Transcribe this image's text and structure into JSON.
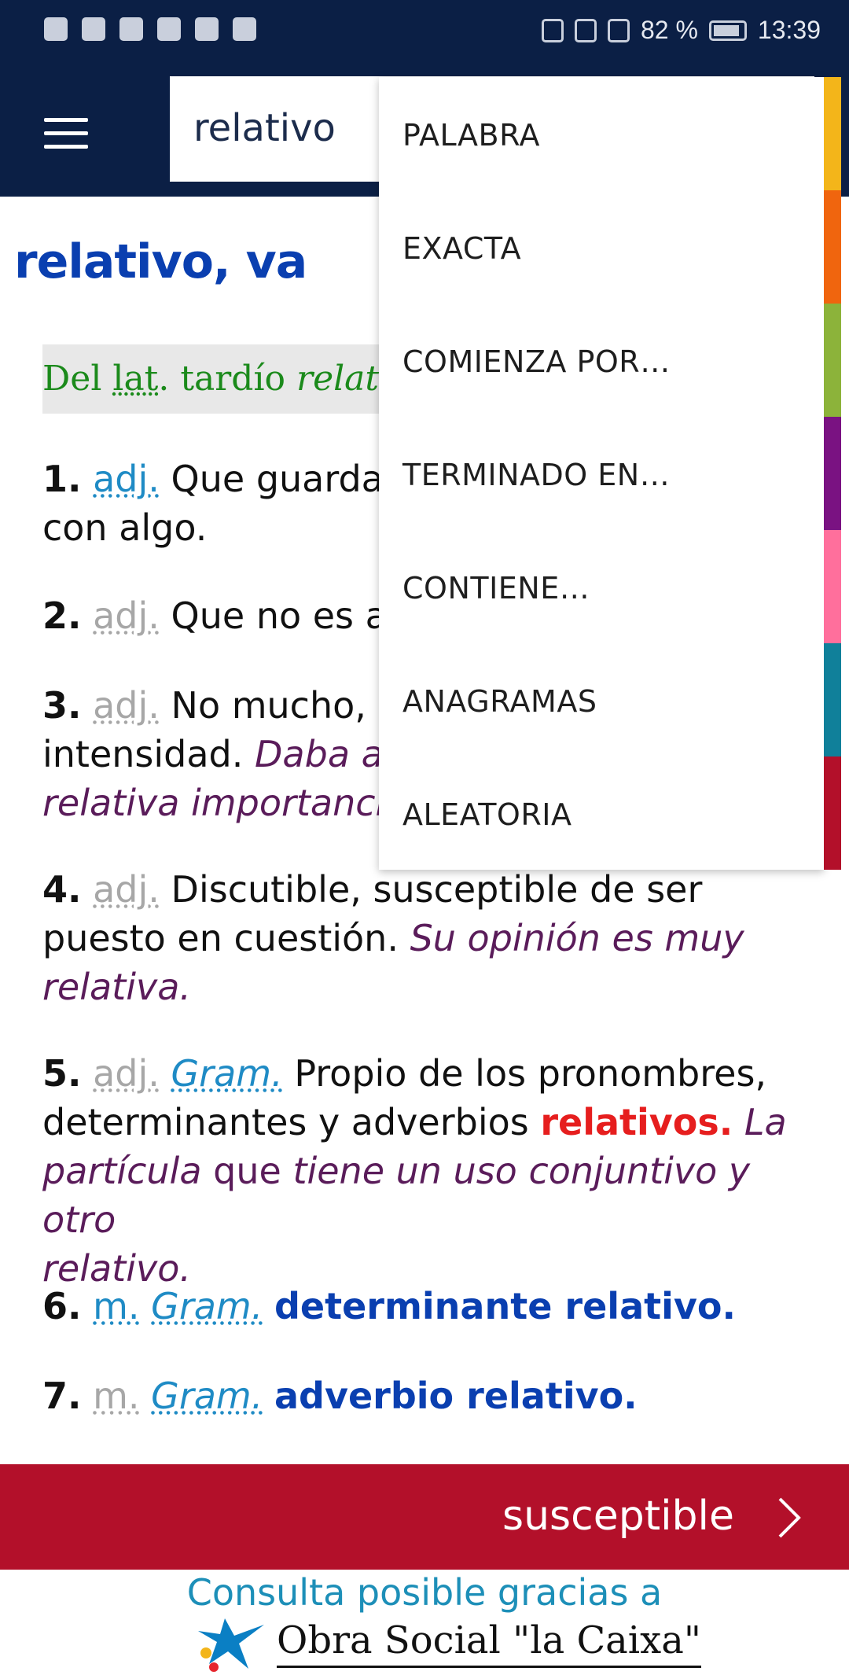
{
  "status_bar": {
    "battery": "82 %",
    "time": "13:39"
  },
  "search": {
    "query": "relativo"
  },
  "entry": {
    "title": "relativo, va",
    "etymology": {
      "prefix": "Del ",
      "abbr": "lat",
      "dot": ".",
      "middle": " tardío ",
      "word": "relatīvus"
    },
    "acepciones": [
      {
        "num": "1.",
        "tag": "adj.",
        "text": "Que guarda",
        "text2": "con algo."
      },
      {
        "num": "2.",
        "tag": "adj.",
        "text": "Que no es a"
      },
      {
        "num": "3.",
        "tag": "adj.",
        "text": "No mucho, e",
        "text2": "intensidad.",
        "example": "Daba a",
        "example2": "relativa importancia"
      },
      {
        "num": "4.",
        "tag": "adj.",
        "text": "Discutible, susceptible de ser",
        "text2": "puesto en cuestión.",
        "example": "Su opinión es muy",
        "example2": "relativa."
      },
      {
        "num": "5.",
        "tag": "adj.",
        "tag2": "Gram.",
        "text": "Propio de los pronombres,",
        "text2": "determinantes y adverbios",
        "highlight": "relativos.",
        "example": "La",
        "example_line3_a": "partícula",
        "example_line3_b": "que",
        "example_line3_c": "tiene un uso conjuntivo y otro",
        "example_line4": "relativo."
      },
      {
        "num": "6.",
        "tag": "m.",
        "tag2": "Gram.",
        "link": "determinante relativo."
      },
      {
        "num": "7.",
        "tag": "m.",
        "tag2": "Gram.",
        "link": "adverbio relativo."
      }
    ]
  },
  "dropdown": {
    "items": [
      "PALABRA",
      "EXACTA",
      "COMIENZA POR…",
      "TERMINADO EN…",
      "CONTIENE…",
      "ANAGRAMAS",
      "ALEATORIA"
    ],
    "colors": [
      "#f3b51a",
      "#f0650e",
      "#8cb33a",
      "#7a1282",
      "#ff6f9c",
      "#10809a",
      "#b3102a"
    ]
  },
  "next": {
    "label": "susceptible"
  },
  "sponsor": {
    "line": "Consulta posible gracias a",
    "name": "Obra Social \"la Caixa\""
  }
}
